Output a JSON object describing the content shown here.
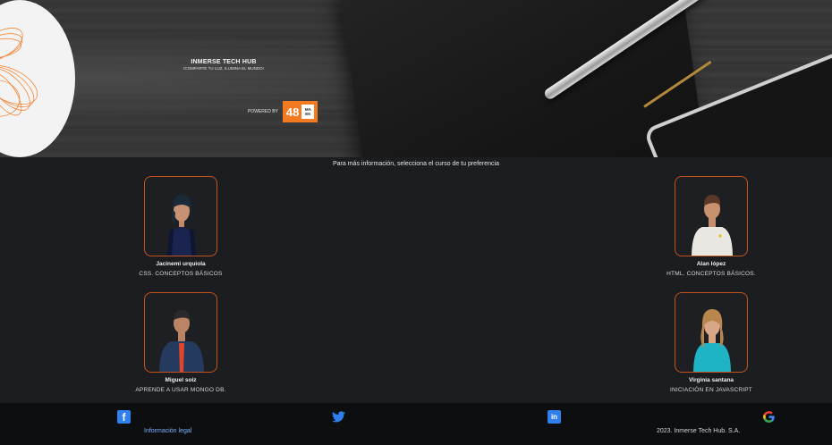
{
  "hero": {
    "title": "INMERSE TECH HUB",
    "subtitle": "ICOMPARTE TU LUZ, ILUMINA EL MUNDO!",
    "powered_label": "POWERED BY",
    "badge_number": "48",
    "badge_text": "MA EK"
  },
  "prompt": "Para más información, selecciona el curso de tu preferencia",
  "cards": [
    {
      "name": "Jacinemi urquiola",
      "course": "CSS. CONCEPTOS BÁSICOS"
    },
    {
      "name": "Alan lópez",
      "course": "HTML. CONCEPTOS BÁSICOS."
    },
    {
      "name": "Miguel soiz",
      "course": "APRENDE A USAR MONGO DB."
    },
    {
      "name": "Virginia santana",
      "course": "INICIACIÓN EN JAVASCRIPT"
    }
  ],
  "footer": {
    "legal": "Información legal",
    "copyright": "2023. Inmerse Tech Hub. S.A.",
    "icons": [
      "facebook-icon",
      "twitter-icon",
      "linkedin-icon",
      "google-icon"
    ]
  },
  "colors": {
    "accent": "#f47a21",
    "card_border": "#c6531c",
    "background": "#1c1d20",
    "footer": "#0d0e10",
    "social_blue": "#2f80ed"
  }
}
